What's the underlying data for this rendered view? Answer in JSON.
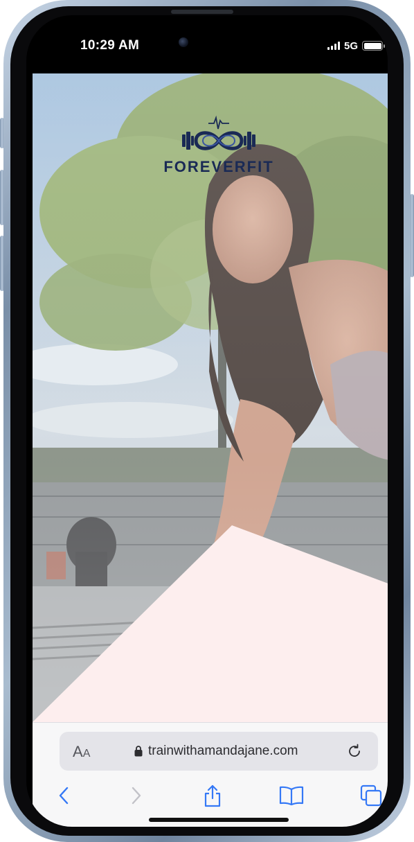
{
  "status_bar": {
    "time": "10:29 AM",
    "network": "5G",
    "icons": [
      "cellular-signal-icon",
      "battery-icon"
    ]
  },
  "page": {
    "brand_name": "FOREVERFIT",
    "logo_icon": "infinity-dumbbell-logo-icon",
    "hero_image": "woman-doing-push-up-outdoors-photo",
    "overlay_color": "#fdeeee",
    "brand_color": "#1a2a55"
  },
  "safari": {
    "text_size_label": "AA",
    "url": "trainwithamandajane.com",
    "icons": [
      "lock-icon",
      "reload-icon",
      "back-icon",
      "forward-icon",
      "share-icon",
      "bookmarks-icon",
      "tabs-icon"
    ],
    "accent_color": "#3478f6"
  }
}
